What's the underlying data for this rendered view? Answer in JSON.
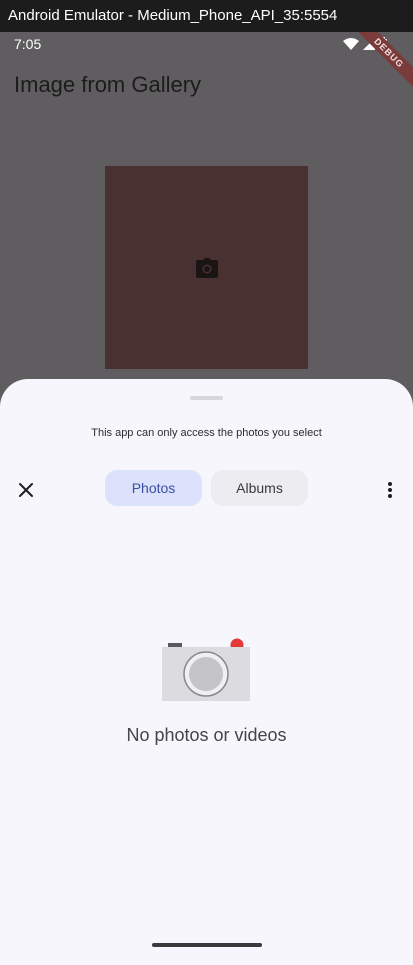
{
  "window": {
    "title": "Android Emulator - Medium_Phone_API_35:5554"
  },
  "statusbar": {
    "time": "7:05",
    "debug_banner": "DEBUG"
  },
  "app": {
    "title": "Image from Gallery"
  },
  "picker": {
    "notice": "This app can only access the photos you select",
    "tabs": [
      {
        "label": "Photos",
        "selected": true
      },
      {
        "label": "Albums",
        "selected": false
      }
    ],
    "empty_message": "No photos or videos"
  },
  "icons": {
    "close": "close-icon",
    "more": "more-vert-icon",
    "camera": "camera-icon",
    "wifi": "wifi-icon",
    "signal": "signal-icon",
    "battery": "battery-icon"
  },
  "colors": {
    "sheet_bg": "#f7f6fc",
    "tab_selected_bg": "#dce2fb",
    "tab_selected_text": "#3a4ea3",
    "scrim_bg": "#5f5d5f",
    "placeholder_bg": "#4a3131",
    "recording_dot": "#e53935"
  }
}
